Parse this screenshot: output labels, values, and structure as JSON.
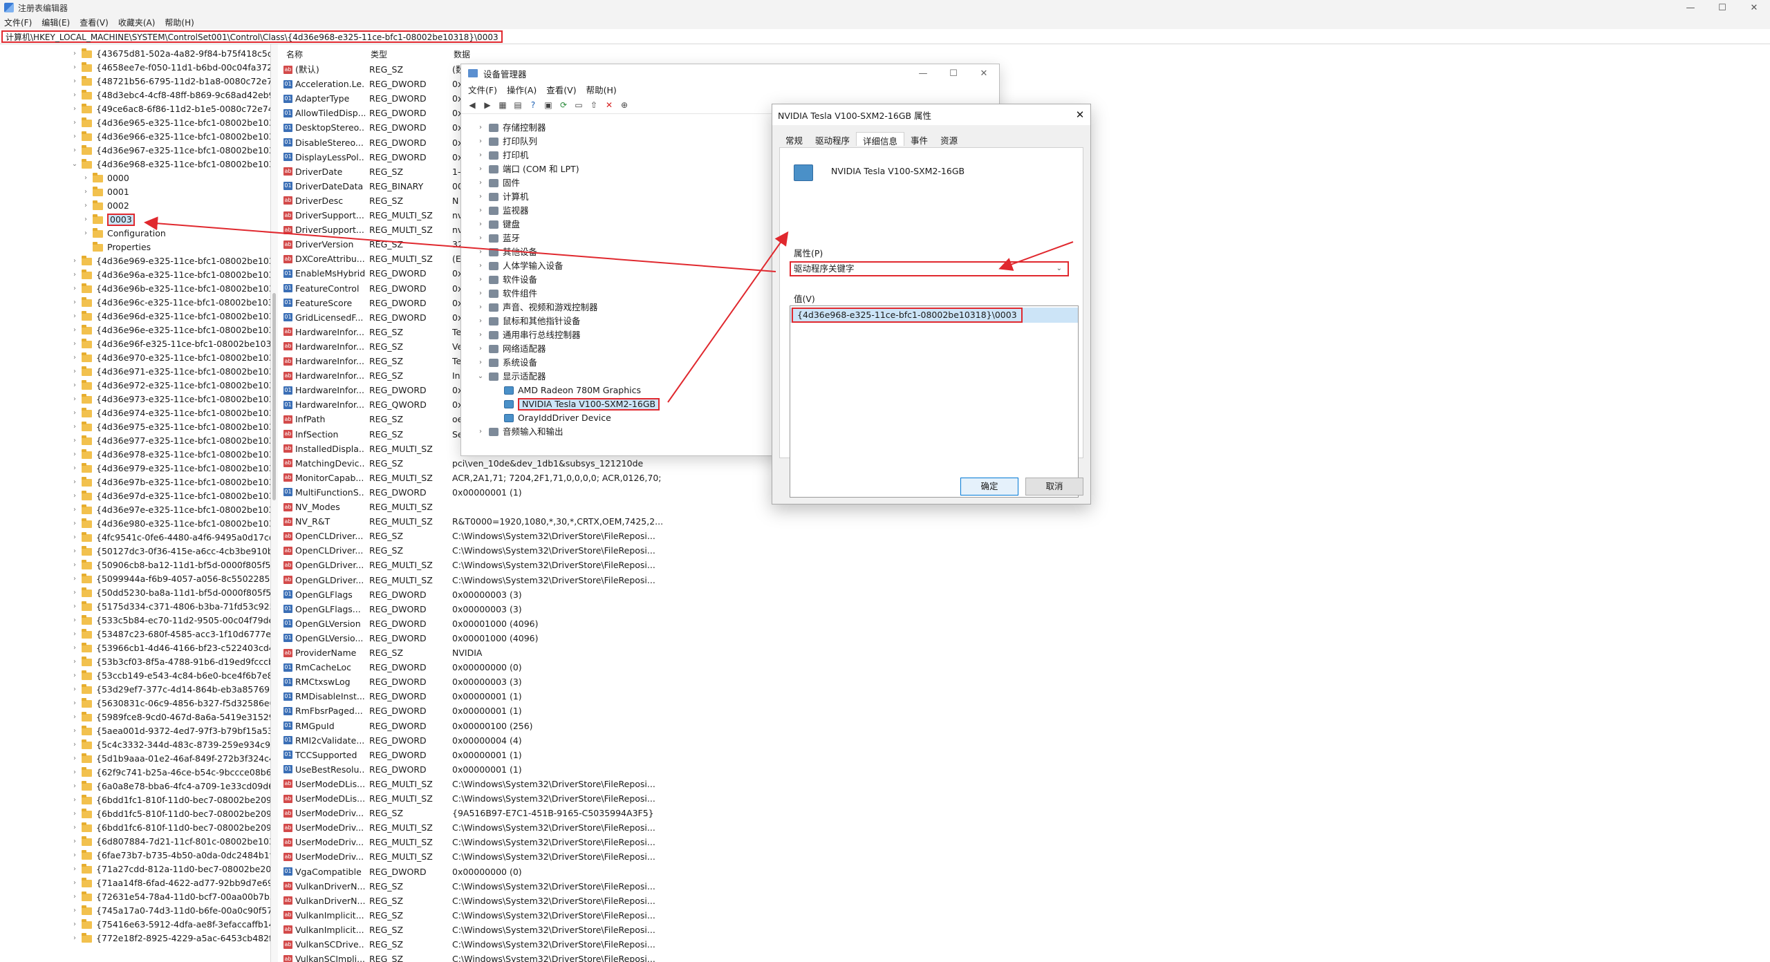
{
  "window": {
    "title": "注册表编辑器",
    "controls": [
      "—",
      "☐",
      "✕"
    ]
  },
  "menu": [
    "文件(F)",
    "编辑(E)",
    "查看(V)",
    "收藏夹(A)",
    "帮助(H)"
  ],
  "address": "计算机\\HKEY_LOCAL_MACHINE\\SYSTEM\\ControlSet001\\Control\\Class\\{4d36e968-e325-11ce-bfc1-08002be10318}\\0003",
  "tree": [
    {
      "label": "{43675d81-502a-4a82-9f84-b75f418c5dea}",
      "indent": 0,
      "chev": ">"
    },
    {
      "label": "{4658ee7e-f050-11d1-b6bd-00c04fa372a7}",
      "indent": 0,
      "chev": ">"
    },
    {
      "label": "{48721b56-6795-11d2-b1a8-0080c72e74a2}",
      "indent": 0,
      "chev": ">"
    },
    {
      "label": "{48d3ebc4-4cf8-48ff-b869-9c68ad42eb9f}",
      "indent": 0,
      "chev": ">"
    },
    {
      "label": "{49ce6ac8-6f86-11d2-b1e5-0080c72e74a2}",
      "indent": 0,
      "chev": ">"
    },
    {
      "label": "{4d36e965-e325-11ce-bfc1-08002be10318}",
      "indent": 0,
      "chev": ">"
    },
    {
      "label": "{4d36e966-e325-11ce-bfc1-08002be10318}",
      "indent": 0,
      "chev": ">"
    },
    {
      "label": "{4d36e967-e325-11ce-bfc1-08002be10318}",
      "indent": 0,
      "chev": ">"
    },
    {
      "label": "{4d36e968-e325-11ce-bfc1-08002be10318}",
      "indent": 0,
      "chev": "v"
    },
    {
      "label": "0000",
      "indent": 1,
      "chev": ">"
    },
    {
      "label": "0001",
      "indent": 1,
      "chev": ">"
    },
    {
      "label": "0002",
      "indent": 1,
      "chev": ">"
    },
    {
      "label": "0003",
      "indent": 1,
      "chev": ">",
      "selected": true
    },
    {
      "label": "Configuration",
      "indent": 1,
      "chev": ">"
    },
    {
      "label": "Properties",
      "indent": 1,
      "chev": ""
    },
    {
      "label": "{4d36e969-e325-11ce-bfc1-08002be10318}",
      "indent": 0,
      "chev": ">"
    },
    {
      "label": "{4d36e96a-e325-11ce-bfc1-08002be10318}",
      "indent": 0,
      "chev": ">"
    },
    {
      "label": "{4d36e96b-e325-11ce-bfc1-08002be10318}",
      "indent": 0,
      "chev": ">"
    },
    {
      "label": "{4d36e96c-e325-11ce-bfc1-08002be10318}",
      "indent": 0,
      "chev": ">"
    },
    {
      "label": "{4d36e96d-e325-11ce-bfc1-08002be10318}",
      "indent": 0,
      "chev": ">"
    },
    {
      "label": "{4d36e96e-e325-11ce-bfc1-08002be10318}",
      "indent": 0,
      "chev": ">"
    },
    {
      "label": "{4d36e96f-e325-11ce-bfc1-08002be10318}",
      "indent": 0,
      "chev": ">"
    },
    {
      "label": "{4d36e970-e325-11ce-bfc1-08002be10318}",
      "indent": 0,
      "chev": ">"
    },
    {
      "label": "{4d36e971-e325-11ce-bfc1-08002be10318}",
      "indent": 0,
      "chev": ">"
    },
    {
      "label": "{4d36e972-e325-11ce-bfc1-08002be10318}",
      "indent": 0,
      "chev": ">"
    },
    {
      "label": "{4d36e973-e325-11ce-bfc1-08002be10318}",
      "indent": 0,
      "chev": ">"
    },
    {
      "label": "{4d36e974-e325-11ce-bfc1-08002be10318}",
      "indent": 0,
      "chev": ">"
    },
    {
      "label": "{4d36e975-e325-11ce-bfc1-08002be10318}",
      "indent": 0,
      "chev": ">"
    },
    {
      "label": "{4d36e977-e325-11ce-bfc1-08002be10318}",
      "indent": 0,
      "chev": ">"
    },
    {
      "label": "{4d36e978-e325-11ce-bfc1-08002be10318}",
      "indent": 0,
      "chev": ">"
    },
    {
      "label": "{4d36e979-e325-11ce-bfc1-08002be10318}",
      "indent": 0,
      "chev": ">"
    },
    {
      "label": "{4d36e97b-e325-11ce-bfc1-08002be10318}",
      "indent": 0,
      "chev": ">"
    },
    {
      "label": "{4d36e97d-e325-11ce-bfc1-08002be10318}",
      "indent": 0,
      "chev": ">"
    },
    {
      "label": "{4d36e97e-e325-11ce-bfc1-08002be10318}",
      "indent": 0,
      "chev": ">"
    },
    {
      "label": "{4d36e980-e325-11ce-bfc1-08002be10318}",
      "indent": 0,
      "chev": ">"
    },
    {
      "label": "{4fc9541c-0fe6-4480-a4f6-9495a0d17cd2}",
      "indent": 0,
      "chev": ">"
    },
    {
      "label": "{50127dc3-0f36-415e-a6cc-4cb3be910b65}",
      "indent": 0,
      "chev": ">"
    },
    {
      "label": "{50906cb8-ba12-11d1-bf5d-0000f805f530}",
      "indent": 0,
      "chev": ">"
    },
    {
      "label": "{5099944a-f6b9-4057-a056-8c550228544c}",
      "indent": 0,
      "chev": ">"
    },
    {
      "label": "{50dd5230-ba8a-11d1-bf5d-0000f805f530}",
      "indent": 0,
      "chev": ">"
    },
    {
      "label": "{5175d334-c371-4806-b3ba-71fd53c9258d}",
      "indent": 0,
      "chev": ">"
    },
    {
      "label": "{533c5b84-ec70-11d2-9505-00c04f79deaf}",
      "indent": 0,
      "chev": ">"
    },
    {
      "label": "{53487c23-680f-4585-acc3-1f10d6777e82}",
      "indent": 0,
      "chev": ">"
    },
    {
      "label": "{53966cb1-4d46-4166-bf23-c522403cd495}",
      "indent": 0,
      "chev": ">"
    },
    {
      "label": "{53b3cf03-8f5a-4788-91b6-d19ed9fcccbf}",
      "indent": 0,
      "chev": ">"
    },
    {
      "label": "{53ccb149-e543-4c84-b6e0-bce4f6b7e806}",
      "indent": 0,
      "chev": ">"
    },
    {
      "label": "{53d29ef7-377c-4d14-864b-eb3a85769359}",
      "indent": 0,
      "chev": ">"
    },
    {
      "label": "{5630831c-06c9-4856-b327-f5d32586e060}",
      "indent": 0,
      "chev": ">"
    },
    {
      "label": "{5989fce8-9cd0-467d-8a6a-5419e31529d4}",
      "indent": 0,
      "chev": ">"
    },
    {
      "label": "{5aea001d-9372-4ed7-97f3-b79bf15a53c5}",
      "indent": 0,
      "chev": ">"
    },
    {
      "label": "{5c4c3332-344d-483c-8739-259e934c9cc8}",
      "indent": 0,
      "chev": ">"
    },
    {
      "label": "{5d1b9aaa-01e2-46af-849f-272b3f324c46}",
      "indent": 0,
      "chev": ">"
    },
    {
      "label": "{62f9c741-b25a-46ce-b54c-9bccce08b6f2}",
      "indent": 0,
      "chev": ">"
    },
    {
      "label": "{6a0a8e78-bba6-4fc4-a709-1e33cd09d67e}",
      "indent": 0,
      "chev": ">"
    },
    {
      "label": "{6bdd1fc1-810f-11d0-bec7-08002be2092f}",
      "indent": 0,
      "chev": ">"
    },
    {
      "label": "{6bdd1fc5-810f-11d0-bec7-08002be2092f}",
      "indent": 0,
      "chev": ">"
    },
    {
      "label": "{6bdd1fc6-810f-11d0-bec7-08002be2092f}",
      "indent": 0,
      "chev": ">"
    },
    {
      "label": "{6d807884-7d21-11cf-801c-08002be10318}",
      "indent": 0,
      "chev": ">"
    },
    {
      "label": "{6fae73b7-b735-4b50-a0da-0dc2484b1f1a}",
      "indent": 0,
      "chev": ">"
    },
    {
      "label": "{71a27cdd-812a-11d0-bec7-08002be2092f}",
      "indent": 0,
      "chev": ">"
    },
    {
      "label": "{71aa14f8-6fad-4622-ad77-92bb9d7e6947}",
      "indent": 0,
      "chev": ">"
    },
    {
      "label": "{72631e54-78a4-11d0-bcf7-00aa00b7b32a}",
      "indent": 0,
      "chev": ">"
    },
    {
      "label": "{745a17a0-74d3-11d0-b6fe-00a0c90f57da}",
      "indent": 0,
      "chev": ">"
    },
    {
      "label": "{75416e63-5912-4dfa-ae8f-3efaccaffb14}",
      "indent": 0,
      "chev": ">"
    },
    {
      "label": "{772e18f2-8925-4229-a5ac-6453cb482fda}",
      "indent": 0,
      "chev": ">"
    }
  ],
  "values": {
    "headers": {
      "name": "名称",
      "type": "类型",
      "data": "数据"
    },
    "rows": [
      {
        "name": "(默认)",
        "type": "REG_SZ",
        "data": "(数",
        "icon": "sz"
      },
      {
        "name": "Acceleration.Le...",
        "type": "REG_DWORD",
        "data": "0x",
        "icon": "bin"
      },
      {
        "name": "AdapterType",
        "type": "REG_DWORD",
        "data": "0x",
        "icon": "bin"
      },
      {
        "name": "AllowTiledDisp...",
        "type": "REG_DWORD",
        "data": "0x",
        "icon": "bin"
      },
      {
        "name": "DesktopStereo...",
        "type": "REG_DWORD",
        "data": "0x",
        "icon": "bin"
      },
      {
        "name": "DisableStereo...",
        "type": "REG_DWORD",
        "data": "0x",
        "icon": "bin"
      },
      {
        "name": "DisplayLessPol...",
        "type": "REG_DWORD",
        "data": "0x",
        "icon": "bin"
      },
      {
        "name": "DriverDate",
        "type": "REG_SZ",
        "data": "1-",
        "icon": "sz"
      },
      {
        "name": "DriverDateData",
        "type": "REG_BINARY",
        "data": "00",
        "icon": "bin"
      },
      {
        "name": "DriverDesc",
        "type": "REG_SZ",
        "data": "N",
        "icon": "sz"
      },
      {
        "name": "DriverSupport...",
        "type": "REG_MULTI_SZ",
        "data": "nv",
        "icon": "sz"
      },
      {
        "name": "DriverSupport...",
        "type": "REG_MULTI_SZ",
        "data": "nv",
        "icon": "sz"
      },
      {
        "name": "DriverVersion",
        "type": "REG_SZ",
        "data": "32",
        "icon": "sz"
      },
      {
        "name": "DXCoreAttribu...",
        "type": "REG_MULTI_SZ",
        "data": "(E",
        "icon": "sz"
      },
      {
        "name": "EnableMsHybrid",
        "type": "REG_DWORD",
        "data": "0x",
        "icon": "bin"
      },
      {
        "name": "FeatureControl",
        "type": "REG_DWORD",
        "data": "0x",
        "icon": "bin"
      },
      {
        "name": "FeatureScore",
        "type": "REG_DWORD",
        "data": "0x",
        "icon": "bin"
      },
      {
        "name": "GridLicensedF...",
        "type": "REG_DWORD",
        "data": "0x",
        "icon": "bin"
      },
      {
        "name": "HardwareInfor...",
        "type": "REG_SZ",
        "data": "Te",
        "icon": "sz"
      },
      {
        "name": "HardwareInfor...",
        "type": "REG_SZ",
        "data": "Ve",
        "icon": "sz"
      },
      {
        "name": "HardwareInfor...",
        "type": "REG_SZ",
        "data": "Te",
        "icon": "sz"
      },
      {
        "name": "HardwareInfor...",
        "type": "REG_SZ",
        "data": "In",
        "icon": "sz"
      },
      {
        "name": "HardwareInfor...",
        "type": "REG_DWORD",
        "data": "0x",
        "icon": "bin"
      },
      {
        "name": "HardwareInfor...",
        "type": "REG_QWORD",
        "data": "0x",
        "icon": "bin"
      },
      {
        "name": "InfPath",
        "type": "REG_SZ",
        "data": "oe",
        "icon": "sz"
      },
      {
        "name": "InfSection",
        "type": "REG_SZ",
        "data": "Se",
        "icon": "sz"
      },
      {
        "name": "InstalledDispla...",
        "type": "REG_MULTI_SZ",
        "data": "",
        "icon": "sz"
      },
      {
        "name": "MatchingDevic...",
        "type": "REG_SZ",
        "data": "pci\\ven_10de&dev_1db1&subsys_121210de",
        "icon": "sz"
      },
      {
        "name": "MonitorCapab...",
        "type": "REG_MULTI_SZ",
        "data": "ACR,2A1,71; 7204,2F1,71,0,0,0,0; ACR,0126,70;",
        "icon": "sz"
      },
      {
        "name": "MultiFunctionS...",
        "type": "REG_DWORD",
        "data": "0x00000001 (1)",
        "icon": "bin"
      },
      {
        "name": "NV_Modes",
        "type": "REG_MULTI_SZ",
        "data": "",
        "icon": "sz"
      },
      {
        "name": "NV_R&T",
        "type": "REG_MULTI_SZ",
        "data": "R&T0000=1920,1080,*,30,*,CRTX,OEM,7425,2...",
        "icon": "sz"
      },
      {
        "name": "OpenCLDriver...",
        "type": "REG_SZ",
        "data": "C:\\Windows\\System32\\DriverStore\\FileReposi...",
        "icon": "sz"
      },
      {
        "name": "OpenCLDriver...",
        "type": "REG_SZ",
        "data": "C:\\Windows\\System32\\DriverStore\\FileReposi...",
        "icon": "sz"
      },
      {
        "name": "OpenGLDriver...",
        "type": "REG_MULTI_SZ",
        "data": "C:\\Windows\\System32\\DriverStore\\FileReposi...",
        "icon": "sz"
      },
      {
        "name": "OpenGLDriver...",
        "type": "REG_MULTI_SZ",
        "data": "C:\\Windows\\System32\\DriverStore\\FileReposi...",
        "icon": "sz"
      },
      {
        "name": "OpenGLFlags",
        "type": "REG_DWORD",
        "data": "0x00000003 (3)",
        "icon": "bin"
      },
      {
        "name": "OpenGLFlags...",
        "type": "REG_DWORD",
        "data": "0x00000003 (3)",
        "icon": "bin"
      },
      {
        "name": "OpenGLVersion",
        "type": "REG_DWORD",
        "data": "0x00001000 (4096)",
        "icon": "bin"
      },
      {
        "name": "OpenGLVersio...",
        "type": "REG_DWORD",
        "data": "0x00001000 (4096)",
        "icon": "bin"
      },
      {
        "name": "ProviderName",
        "type": "REG_SZ",
        "data": "NVIDIA",
        "icon": "sz"
      },
      {
        "name": "RmCacheLoc",
        "type": "REG_DWORD",
        "data": "0x00000000 (0)",
        "icon": "bin"
      },
      {
        "name": "RMCtxswLog",
        "type": "REG_DWORD",
        "data": "0x00000003 (3)",
        "icon": "bin"
      },
      {
        "name": "RMDisableInst...",
        "type": "REG_DWORD",
        "data": "0x00000001 (1)",
        "icon": "bin"
      },
      {
        "name": "RmFbsrPaged...",
        "type": "REG_DWORD",
        "data": "0x00000001 (1)",
        "icon": "bin"
      },
      {
        "name": "RMGpuId",
        "type": "REG_DWORD",
        "data": "0x00000100 (256)",
        "icon": "bin"
      },
      {
        "name": "RMI2cValidate...",
        "type": "REG_DWORD",
        "data": "0x00000004 (4)",
        "icon": "bin"
      },
      {
        "name": "TCCSupported",
        "type": "REG_DWORD",
        "data": "0x00000001 (1)",
        "icon": "bin"
      },
      {
        "name": "UseBestResolu...",
        "type": "REG_DWORD",
        "data": "0x00000001 (1)",
        "icon": "bin"
      },
      {
        "name": "UserModeDLis...",
        "type": "REG_MULTI_SZ",
        "data": "C:\\Windows\\System32\\DriverStore\\FileReposi...",
        "icon": "sz"
      },
      {
        "name": "UserModeDLis...",
        "type": "REG_MULTI_SZ",
        "data": "C:\\Windows\\System32\\DriverStore\\FileReposi...",
        "icon": "sz"
      },
      {
        "name": "UserModeDriv...",
        "type": "REG_SZ",
        "data": "{9A516B97-E7C1-451B-9165-C5035994A3F5}",
        "icon": "sz"
      },
      {
        "name": "UserModeDriv...",
        "type": "REG_MULTI_SZ",
        "data": "C:\\Windows\\System32\\DriverStore\\FileReposi...",
        "icon": "sz"
      },
      {
        "name": "UserModeDriv...",
        "type": "REG_MULTI_SZ",
        "data": "C:\\Windows\\System32\\DriverStore\\FileReposi...",
        "icon": "sz"
      },
      {
        "name": "UserModeDriv...",
        "type": "REG_MULTI_SZ",
        "data": "C:\\Windows\\System32\\DriverStore\\FileReposi...",
        "icon": "sz"
      },
      {
        "name": "VgaCompatible",
        "type": "REG_DWORD",
        "data": "0x00000000 (0)",
        "icon": "bin"
      },
      {
        "name": "VulkanDriverN...",
        "type": "REG_SZ",
        "data": "C:\\Windows\\System32\\DriverStore\\FileReposi...",
        "icon": "sz"
      },
      {
        "name": "VulkanDriverN...",
        "type": "REG_SZ",
        "data": "C:\\Windows\\System32\\DriverStore\\FileReposi...",
        "icon": "sz"
      },
      {
        "name": "VulkanImplicit...",
        "type": "REG_SZ",
        "data": "C:\\Windows\\System32\\DriverStore\\FileReposi...",
        "icon": "sz"
      },
      {
        "name": "VulkanImplicit...",
        "type": "REG_SZ",
        "data": "C:\\Windows\\System32\\DriverStore\\FileReposi...",
        "icon": "sz"
      },
      {
        "name": "VulkanSCDrive...",
        "type": "REG_SZ",
        "data": "C:\\Windows\\System32\\DriverStore\\FileReposi...",
        "icon": "sz"
      },
      {
        "name": "VulkanSCImpli...",
        "type": "REG_SZ",
        "data": "C:\\Windows\\System32\\DriverStore\\FileReposi...",
        "icon": "sz"
      }
    ]
  },
  "devmgr": {
    "title": "设备管理器",
    "menu": [
      "文件(F)",
      "操作(A)",
      "查看(V)",
      "帮助(H)"
    ],
    "tree": [
      {
        "label": "存储控制器",
        "indent": 0,
        "chev": ">"
      },
      {
        "label": "打印队列",
        "indent": 0,
        "chev": ">"
      },
      {
        "label": "打印机",
        "indent": 0,
        "chev": ">"
      },
      {
        "label": "端口 (COM 和 LPT)",
        "indent": 0,
        "chev": ">"
      },
      {
        "label": "固件",
        "indent": 0,
        "chev": ">"
      },
      {
        "label": "计算机",
        "indent": 0,
        "chev": ">"
      },
      {
        "label": "监视器",
        "indent": 0,
        "chev": ">"
      },
      {
        "label": "键盘",
        "indent": 0,
        "chev": ">"
      },
      {
        "label": "蓝牙",
        "indent": 0,
        "chev": ">"
      },
      {
        "label": "其他设备",
        "indent": 0,
        "chev": ">"
      },
      {
        "label": "人体学输入设备",
        "indent": 0,
        "chev": ">"
      },
      {
        "label": "软件设备",
        "indent": 0,
        "chev": ">"
      },
      {
        "label": "软件组件",
        "indent": 0,
        "chev": ">"
      },
      {
        "label": "声音、视频和游戏控制器",
        "indent": 0,
        "chev": ">"
      },
      {
        "label": "鼠标和其他指针设备",
        "indent": 0,
        "chev": ">"
      },
      {
        "label": "通用串行总线控制器",
        "indent": 0,
        "chev": ">"
      },
      {
        "label": "网络适配器",
        "indent": 0,
        "chev": ">"
      },
      {
        "label": "系统设备",
        "indent": 0,
        "chev": ">"
      },
      {
        "label": "显示适配器",
        "indent": 0,
        "chev": "v"
      },
      {
        "label": "AMD Radeon 780M Graphics",
        "indent": 1,
        "chev": ""
      },
      {
        "label": "NVIDIA Tesla V100-SXM2-16GB",
        "indent": 1,
        "chev": "",
        "selected": true
      },
      {
        "label": "OrayIddDriver Device",
        "indent": 1,
        "chev": ""
      },
      {
        "label": "音频输入和输出",
        "indent": 0,
        "chev": ">"
      }
    ]
  },
  "props": {
    "title": "NVIDIA Tesla V100-SXM2-16GB 属性",
    "tabs": [
      "常规",
      "驱动程序",
      "详细信息",
      "事件",
      "资源"
    ],
    "active_tab": 2,
    "device_name": "NVIDIA Tesla V100-SXM2-16GB",
    "property_label": "属性(P)",
    "property_value": "驱动程序关键字",
    "value_label": "值(V)",
    "value": "{4d36e968-e325-11ce-bfc1-08002be10318}\\0003",
    "ok": "确定",
    "cancel": "取消"
  },
  "colors": {
    "highlight": "#e0282e",
    "selection": "#cce4f7",
    "folder": "#f2c14e"
  }
}
